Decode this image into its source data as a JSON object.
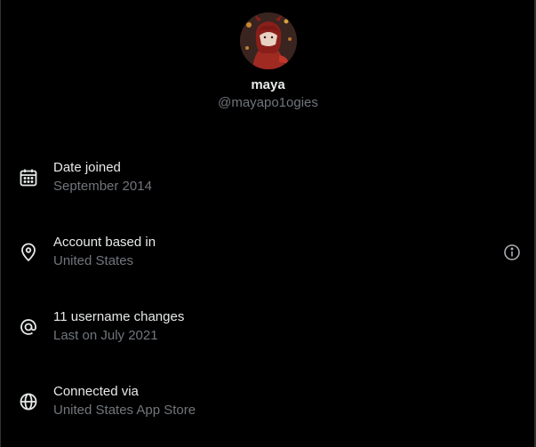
{
  "profile": {
    "display_name": "maya",
    "handle": "@mayapo1ogies"
  },
  "about": {
    "items": [
      {
        "icon": "calendar-icon",
        "title": "Date joined",
        "subtitle": "September 2014"
      },
      {
        "icon": "location-pin-icon",
        "title": "Account based in",
        "subtitle": "United States",
        "trailing_icon": "info-icon"
      },
      {
        "icon": "at-sign-icon",
        "title": "11 username changes",
        "subtitle": "Last on July 2021"
      },
      {
        "icon": "globe-icon",
        "title": "Connected via",
        "subtitle": "United States App Store"
      }
    ]
  },
  "colors": {
    "background": "#000000",
    "primary_text": "#e7e9ea",
    "secondary_text": "#71767b",
    "border": "#2f3336"
  }
}
